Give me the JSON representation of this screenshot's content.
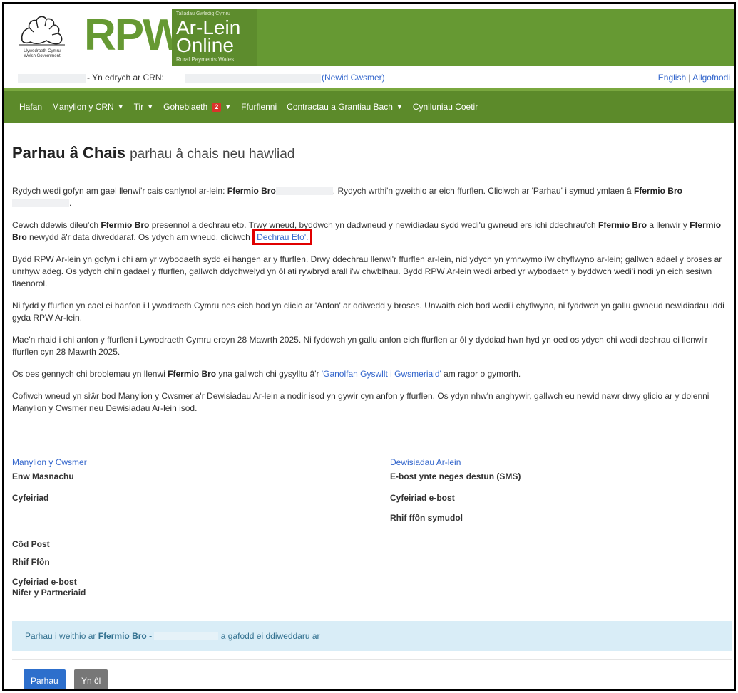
{
  "header": {
    "gov_name_line1": "Llywodraeth Cymru",
    "gov_name_line2": "Welsh Government",
    "logo_text": "RPW",
    "tagline": "Taliadau Gwledig Cymru",
    "ar_lein": "Ar-Lein",
    "online": "Online",
    "rpw_wales": "Rural Payments Wales"
  },
  "crn_row": {
    "label": "- Yn edrych ar CRN:",
    "change_customer": "(Newid Cwsmer)",
    "english": "English",
    "separator": "|",
    "logout": "Allgofnodi"
  },
  "nav": {
    "home": "Hafan",
    "crn_details": "Manylion y CRN",
    "land": "Tir",
    "correspondence": "Gohebiaeth",
    "correspondence_count": "2",
    "forms": "Ffurflenni",
    "contracts": "Contractau a Grantiau Bach",
    "woodland": "Cynlluniau Coetir"
  },
  "page": {
    "title": "Parhau â Chais",
    "subtitle": "parhau â chais neu hawliad"
  },
  "content": {
    "p1_a": "Rydych wedi gofyn am gael llenwi'r cais canlynol ar-lein: ",
    "p1_b": "Ffermio Bro",
    "p1_c": ". Rydych wrthi'n gweithio ar eich ffurflen. Cliciwch ar 'Parhau' i symud ymlaen â ",
    "p1_d": "Ffermio Bro",
    "p1_e": ".",
    "p2_a": "Cewch ddewis dileu'ch ",
    "p2_b": "Ffermio Bro",
    "p2_c": " presennol a dechrau eto. Trwy wneud, byddwch yn dadwneud y newidiadau sydd wedi'u gwneud ers ichi ddechrau'ch ",
    "p2_d": "Ffermio Bro",
    "p2_e": " a llenwir y ",
    "p2_f": "Ffermio Bro",
    "p2_g": " newydd â'r data diweddaraf. Os ydych am wneud, cliciwch ",
    "p2_link": "Dechrau Eto'.",
    "p3": "Bydd RPW Ar-lein yn gofyn i chi am yr wybodaeth sydd ei hangen ar y ffurflen. Drwy ddechrau llenwi'r ffurflen ar-lein, nid ydych yn ymrwymo i'w chyflwyno ar-lein; gallwch adael y broses ar unrhyw adeg. Os ydych chi'n gadael y ffurflen, gallwch ddychwelyd yn ôl ati rywbryd arall i'w chwblhau. Bydd RPW Ar-lein wedi arbed yr wybodaeth y byddwch wedi'i nodi yn eich sesiwn flaenorol.",
    "p4": "Ni fydd y ffurflen yn cael ei hanfon i Lywodraeth Cymru nes eich bod yn clicio ar 'Anfon' ar ddiwedd y broses. Unwaith eich bod wedi'i chyflwyno, ni fyddwch yn gallu gwneud newidiadau iddi gyda RPW Ar-lein.",
    "p5": "Mae'n rhaid i chi anfon y ffurflen i Lywodraeth Cymru erbyn 28 Mawrth 2025. Ni fyddwch yn gallu anfon eich ffurflen ar ôl y dyddiad hwn hyd yn oed os ydych chi wedi dechrau ei llenwi'r ffurflen cyn 28 Mawrth 2025.",
    "p6_a": "Os oes gennych chi broblemau yn llenwi ",
    "p6_b": "Ffermio Bro",
    "p6_c": " yna gallwch chi gysylltu â'r ",
    "p6_link": "'Ganolfan Gyswllt i Gwsmeriaid'",
    "p6_d": " am ragor o gymorth.",
    "p7": "Cofiwch wneud yn siŵr bod Manylion y Cwsmer a'r Dewisiadau Ar-lein a nodir isod yn gywir cyn anfon y ffurflen. Os ydyn nhw'n anghywir, gallwch eu newid nawr drwy glicio ar y dolenni Manylion y Cwsmer neu Dewisiadau Ar-lein isod."
  },
  "customer_details": {
    "heading": "Manylion y Cwsmer",
    "trading_name": "Enw Masnachu",
    "address": "Cyfeiriad",
    "postcode": "Côd Post",
    "phone": "Rhif Ffôn",
    "email": "Cyfeiriad e-bost",
    "partners": "Nifer y Partneriaid"
  },
  "online_options": {
    "heading": "Dewisiadau Ar-lein",
    "email_or_sms": "E-bost ynte neges destun (SMS)",
    "email": "Cyfeiriad e-bost",
    "mobile": "Rhif ffôn symudol"
  },
  "notice": {
    "text_a": "Parhau i weithio ar ",
    "text_b": "Ffermio Bro -",
    "text_c": "a gafodd ei ddiweddaru ar"
  },
  "buttons": {
    "continue": "Parhau",
    "back": "Yn ôl"
  }
}
